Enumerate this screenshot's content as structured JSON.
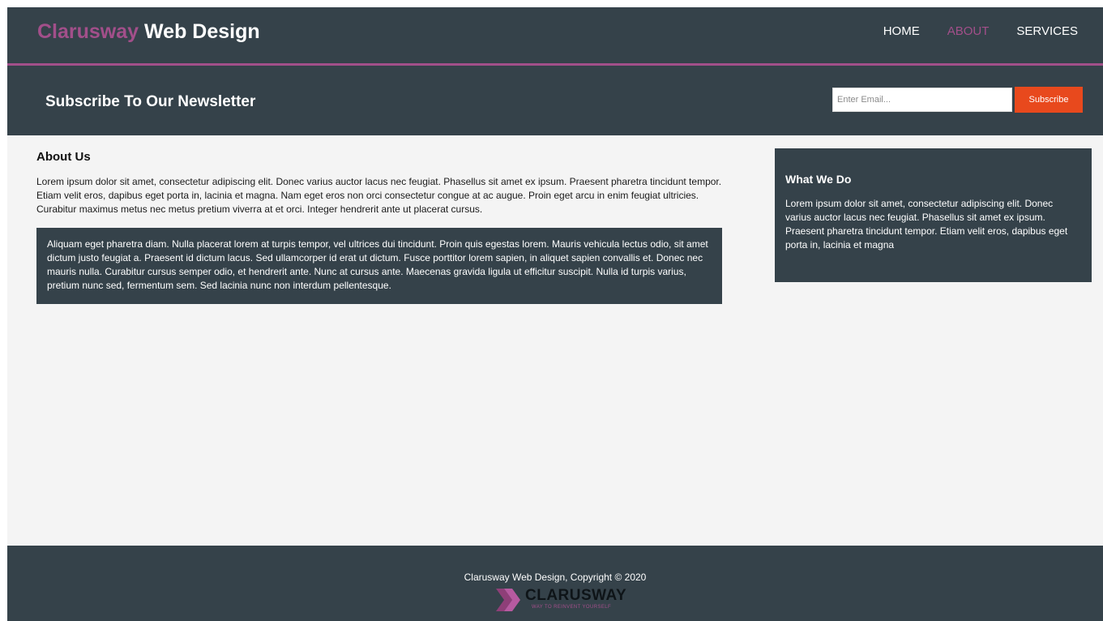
{
  "header": {
    "brand_highlight": "Clarusway",
    "brand_rest": "Web Design",
    "nav": [
      {
        "label": "HOME"
      },
      {
        "label": "ABOUT"
      },
      {
        "label": "SERVICES"
      }
    ]
  },
  "newsletter": {
    "title": "Subscribe To Our Newsletter",
    "email_placeholder": "Enter Email...",
    "email_value": "",
    "button_label": "Subscribe"
  },
  "about": {
    "heading": "About Us",
    "paragraph": "Lorem ipsum dolor sit amet, consectetur adipiscing elit. Donec varius auctor lacus nec feugiat. Phasellus sit amet ex ipsum. Praesent pharetra tincidunt tempor. Etiam velit eros, dapibus eget porta in, lacinia et magna. Nam eget eros non orci consectetur congue at ac augue. Proin eget arcu in enim feugiat ultricies. Curabitur maximus metus nec metus pretium viverra at et orci. Integer hendrerit ante ut placerat cursus.",
    "dark_paragraph": "Aliquam eget pharetra diam. Nulla placerat lorem at turpis tempor, vel ultrices dui tincidunt. Proin quis egestas lorem. Mauris vehicula lectus odio, sit amet dictum justo feugiat a. Praesent id dictum lacus. Sed ullamcorper id erat ut dictum. Fusce porttitor lorem sapien, in aliquet sapien convallis et. Donec nec mauris nulla. Curabitur cursus semper odio, et hendrerit ante. Nunc at cursus ante. Maecenas gravida ligula ut efficitur suscipit. Nulla id turpis varius, pretium nunc sed, fermentum sem. Sed lacinia nunc non interdum pellentesque."
  },
  "sidebar": {
    "heading": "What We Do",
    "paragraph": "Lorem ipsum dolor sit amet, consectetur adipiscing elit. Donec varius auctor lacus nec feugiat. Phasellus sit amet ex ipsum. Praesent pharetra tincidunt tempor. Etiam velit eros, dapibus eget porta in, lacinia et magna"
  },
  "footer": {
    "copyright": "Clarusway Web Design, Copyright © 2020",
    "logo_word": "CLARUSWAY",
    "logo_tagline": "WAY TO REINVENT YOURSELF",
    "logo_icon": "chevron-arrows-icon"
  },
  "colors": {
    "dark": "#35424a",
    "accent": "#a24f8a",
    "button": "#e8491d",
    "background": "#f4f4f4"
  }
}
